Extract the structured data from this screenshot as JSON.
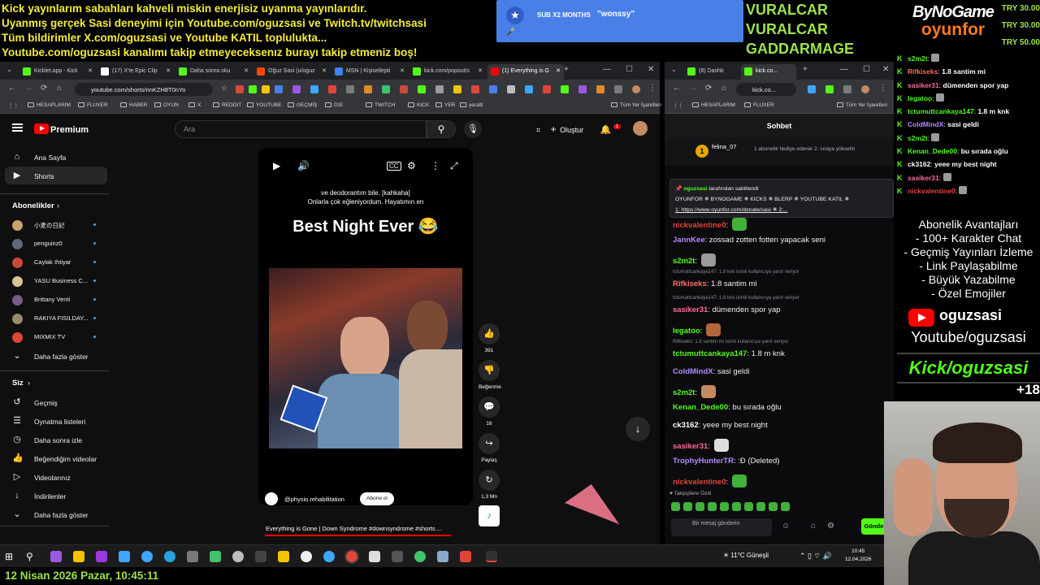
{
  "top_banner": {
    "lines": [
      "Kick yayınlarım sabahları kahveli miskin enerjisiz uyanma yayınlarıdır.",
      "Uyanmış gerçek Sasi deneyimi için Youtube.com/oguzsasi ve Twitch.tv/twitchsasi",
      "Tüm bildirimler X.com/oguzsasi ve Youtube KATIL toplulukta...",
      "Youtube.com/oguzsasi kanalımı takip etmeyeceksenız burayı takip etmeniz boş!"
    ]
  },
  "sub_alert": {
    "label": "SUB X2 MONTHS",
    "user": "\"wonssy\""
  },
  "top_names": [
    "VURALCAR",
    "VURALCAR",
    "GADDARMAGE"
  ],
  "brand": {
    "top": "ByNoGame",
    "bottom": "oyunfor"
  },
  "try_amounts": [
    "TRY 30.00",
    "TRY 30.00",
    "TRY 50.00"
  ],
  "browser_left": {
    "tabs": [
      {
        "label": "Kicklet.app - Kick",
        "color": "#53fc18"
      },
      {
        "label": "(17) X'te Epic Clip",
        "color": "#ffffff"
      },
      {
        "label": "Daha sonra oku",
        "color": "#53fc18"
      },
      {
        "label": "Oğuz Sasi (u/oguz",
        "color": "#ff4500"
      },
      {
        "label": "MSN | Kişisellepti",
        "color": "#3b82f6"
      },
      {
        "label": "kick.com/popout/s",
        "color": "#53fc18"
      },
      {
        "label": "(1) Everything is G",
        "color": "#ff0000"
      }
    ],
    "url": "youtube.com/shorts/nnKZH8T0nYo",
    "bookmarks": [
      "HESAPLARIM",
      "FLUXER",
      "HABER",
      "OYUN",
      "X",
      "REDDIT",
      "YOUTUBE",
      "GEÇMİŞ",
      "DSİ",
      "TWITCH",
      "KICK",
      "YER",
      "yeralti",
      "Tüm Yer İşaretleri"
    ]
  },
  "youtube": {
    "logo": "Premium",
    "search_placeholder": "Ara",
    "create_label": "Oluştur",
    "notif_count": "1",
    "nav": [
      {
        "label": "Ana Sayfa",
        "icon": "home-icon",
        "glyph": "⌂"
      },
      {
        "label": "Shorts",
        "icon": "shorts-icon",
        "glyph": "▶"
      }
    ],
    "subs_header": "Abonelikler",
    "channels": [
      {
        "name": "小麦の日記",
        "color": "#c8a46b"
      },
      {
        "name": "penguinz0",
        "color": "#5b6b7a"
      },
      {
        "name": "Caylak Ihtiyar",
        "color": "#c94a3a"
      },
      {
        "name": "YASU Business C...",
        "color": "#d9c59a"
      },
      {
        "name": "Brittany Venti",
        "color": "#7a5a8a"
      },
      {
        "name": "RAKIYA FISILDAY...",
        "color": "#9a8a6a"
      },
      {
        "name": "MIXMIX TV",
        "color": "#e0453a"
      }
    ],
    "show_more": "Daha fazla göster",
    "you_header": "Siz",
    "you_items": [
      {
        "label": "Geçmiş",
        "glyph": "↺"
      },
      {
        "label": "Oynatma listeleri",
        "glyph": "☰"
      },
      {
        "label": "Daha sonra izle",
        "glyph": "◷"
      },
      {
        "label": "Beğendiğim videolar",
        "glyph": "👍"
      },
      {
        "label": "Videolarınız",
        "glyph": "▷"
      },
      {
        "label": "İndirilenler",
        "glyph": "↓"
      },
      {
        "label": "Daha fazla göster",
        "glyph": "⌄"
      }
    ],
    "short": {
      "caption1": "ve deodorantım bile. [kahkaha]",
      "caption2": "Onlarla çok eğleniyordum.  Hayatımın en",
      "overlay_title": "Best Night Ever 😂",
      "channel": "@physio.rehabilitation",
      "subscribe": "Abone ol",
      "title": "Everything is Gone | Down Syndrome #downsyndrome #shorts ...",
      "likes": "391",
      "dislike_label": "Beğenme",
      "comments": "16",
      "share_label": "Paylaş",
      "remix_count": "1,3 Mn"
    }
  },
  "browser_right": {
    "tabs": [
      "(8) Dashb",
      "kick.co..."
    ],
    "url": "kick.co...",
    "bookmarks": [
      "HESAPLARIM",
      "FLUXER",
      "Tüm Yer İşaretleri"
    ],
    "chat_title": "Sohbet",
    "gift_user": "felina_07",
    "gift_text": "1 abonelik hediye ederek 2. sıraya yükselin",
    "pinned_by": "oguzsasi",
    "pinned_label": "tarafından sabitlendi",
    "pinned_text": "OYUNFOR ✵ BYNOGAME ✵ KICKS ✵ BLERP ✵ YOUTUBE KATIL ✵",
    "pinned_link": "1: https://www.oyunfor.com/donate/sasi ✵ 2:...",
    "messages": [
      {
        "user": "nickvalentine0",
        "text": "",
        "color": "#e0453a",
        "emote": true,
        "emote_color": "#40b23a"
      },
      {
        "user": "JannKee",
        "text": "zossad zotten fotten yapacak seni",
        "color": "#b38cff"
      },
      {
        "user": "s2m2t",
        "text": "",
        "color": "#53fc18",
        "emote": true,
        "emote_color": "#9a9a9a"
      },
      {
        "reply": "tctumuttcankaya147: 1.8 knk isimli kullanıcıya yanıt veriyor"
      },
      {
        "user": "Rifkiseks",
        "text": "1.8 santim mi",
        "color": "#ff6b6b"
      },
      {
        "reply": "tctumuttcankaya147: 1.8 knk isimli kullanıcıya yanıt veriyor"
      },
      {
        "user": "sasiker31",
        "text": "dümenden spor yap",
        "color": "#ff6b9a"
      },
      {
        "user": "legatoo",
        "text": "",
        "color": "#53fc18",
        "emote": true,
        "emote_color": "#b5653a"
      },
      {
        "reply": "Rifkiseks: 1.8 santim mi  isimli kullanıcıya yanıt veriyor"
      },
      {
        "user": "tctumuttcankaya147",
        "text": "1.8 m knk",
        "color": "#53fc18"
      },
      {
        "user": "ColdMindX",
        "text": "sasi geldi",
        "color": "#b38cff"
      },
      {
        "user": "s2m2t",
        "text": "",
        "color": "#53fc18",
        "emote": true,
        "emote_color": "#c48a62"
      },
      {
        "user": "Kenan_Dede00",
        "text": "bu sırada oğlu",
        "color": "#53fc18"
      },
      {
        "user": "ck3162",
        "text": "yeee my best night",
        "color": "#ffffff"
      },
      {
        "user": "sasiker31",
        "text": "",
        "color": "#ff6b9a",
        "emote": true,
        "emote_color": "#dddddd"
      },
      {
        "user": "TrophyHunterTR",
        "text": ":Ð (Deleted)",
        "color": "#b38cff"
      },
      {
        "user": "nickvalentine0",
        "text": "",
        "color": "#e0453a",
        "emote": true,
        "emote_color": "#40b23a"
      }
    ],
    "followers_only": "Takipçilere Özel",
    "input_placeholder": "Bir mesaj gönderin",
    "send_label": "Gönder"
  },
  "overlay_chat": [
    {
      "user": "s2m2t",
      "text": "",
      "color": "#53fc18"
    },
    {
      "user": "Rifkiseks",
      "text": "1.8 santim mi",
      "color": "#ff6b6b"
    },
    {
      "user": "sasiker31",
      "text": "dümenden spor yap",
      "color": "#ff6b9a"
    },
    {
      "user": "legatoo",
      "text": "",
      "color": "#53fc18"
    },
    {
      "user": "tctumuttcankaya147",
      "text": "1.8 m knk",
      "color": "#53fc18"
    },
    {
      "user": "ColdMindX",
      "text": "sasi geldi",
      "color": "#b38cff"
    },
    {
      "user": "s2m2t",
      "text": "",
      "color": "#53fc18"
    },
    {
      "user": "Kenan_Dede00",
      "text": "bu sırada oğlu",
      "color": "#53fc18"
    },
    {
      "user": "ck3162",
      "text": "yeee my best night",
      "color": "#ffffff"
    },
    {
      "user": "sasiker31",
      "text": "",
      "color": "#ff6b9a"
    },
    {
      "user": "nickvalentine0",
      "text": "",
      "color": "#e0453a"
    }
  ],
  "perks": {
    "title": "Abonelik Avantajları",
    "items": [
      "- 100+ Karakter Chat",
      "- Geçmiş Yayınları İzleme",
      "- Link Paylaşabilme",
      "- Büyük Yazabilme",
      "- Özel Emojiler"
    ]
  },
  "promo": {
    "yt_name": "oguzsasi",
    "yt_path": "Youtube/oguzsasi",
    "kick": "Kick/oguzsasi",
    "age": "+18"
  },
  "taskbar": {
    "weather": "11°C  Güneşli",
    "time": "10:45",
    "date": "12.04.2026"
  },
  "date_bar": "12 Nisan 2026 Pazar, 10:45:11"
}
